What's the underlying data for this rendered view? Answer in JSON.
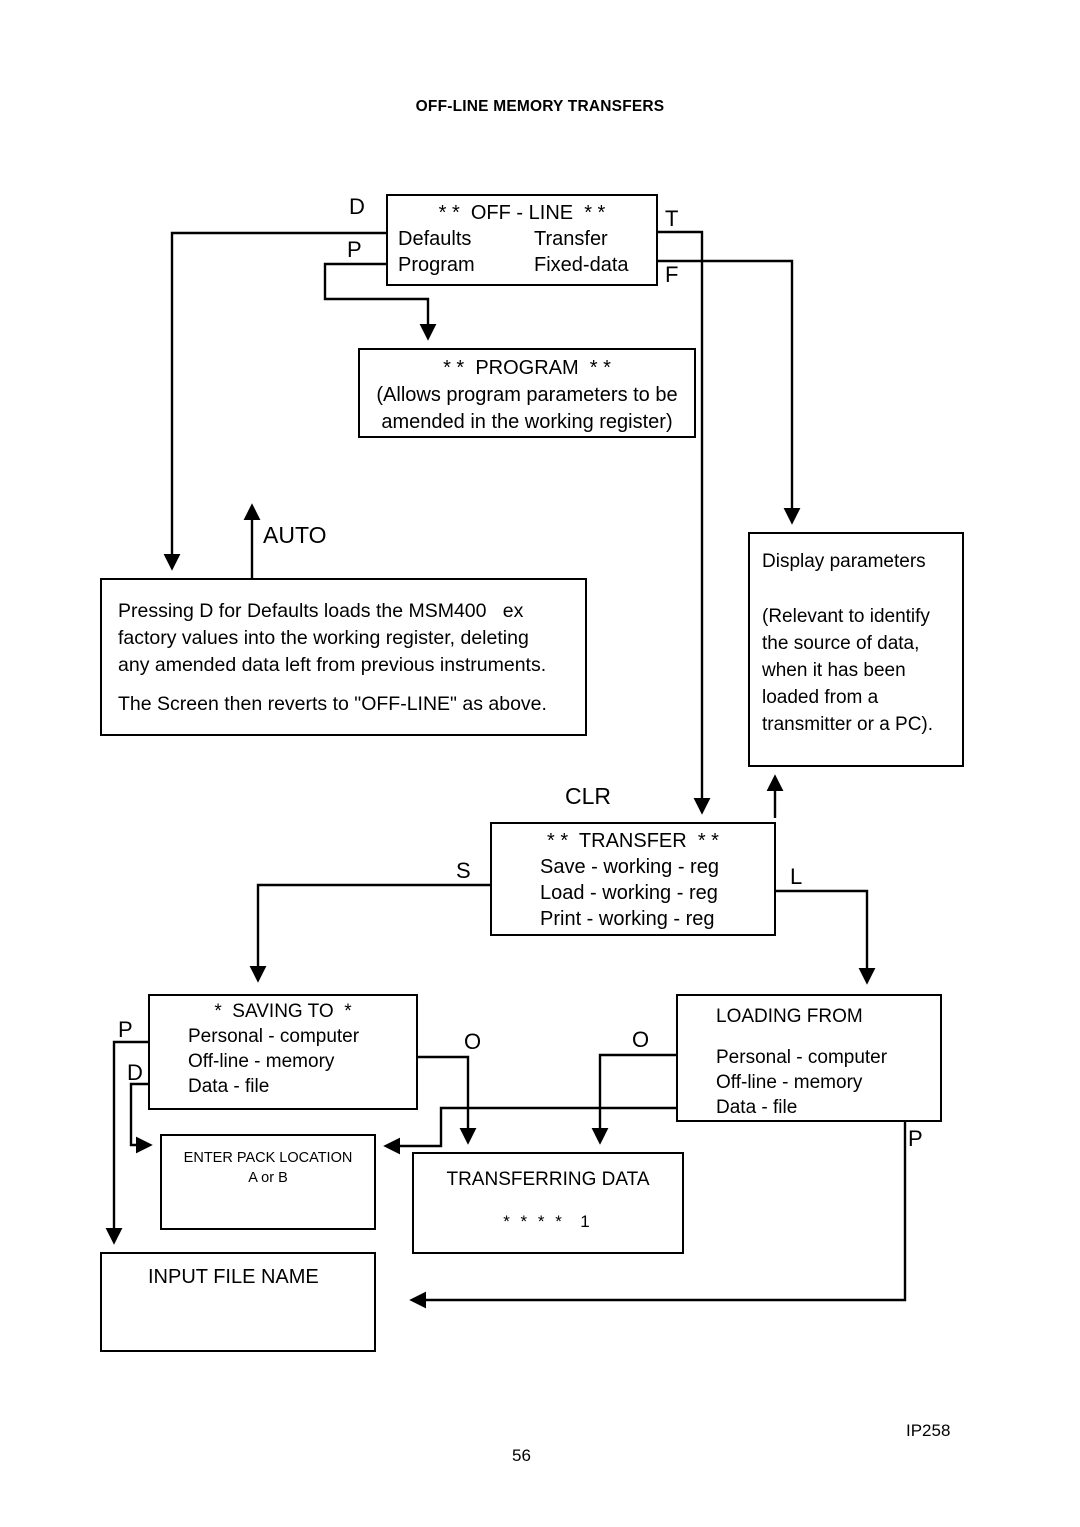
{
  "page": {
    "title": "OFF-LINE MEMORY TRANSFERS",
    "page_number": "56",
    "doc_code": "IP258"
  },
  "nodes": {
    "offline": {
      "header": "* *  OFF - LINE  * *",
      "rows": [
        {
          "left": "Defaults",
          "right": "Transfer"
        },
        {
          "left": "Program",
          "right": "Fixed-data"
        }
      ]
    },
    "program": {
      "header": "* *  PROGRAM  * *",
      "line1": "(Allows program parameters to be",
      "line2": "amended in the working register)"
    },
    "defaults": {
      "line1": "Pressing D for Defaults loads the MSM400   ex",
      "line2": "factory values into the working register, deleting",
      "line3": "any amended data left from previous instruments.",
      "line4": "The Screen then reverts to \"OFF-LINE\" as above."
    },
    "display": {
      "line1": "Display parameters",
      "line2": "(Relevant to identify",
      "line3": "the source of data,",
      "line4": "when it has been",
      "line5": "loaded from a",
      "line6": "transmitter or a PC)."
    },
    "transfer": {
      "header": "* *  TRANSFER  * *",
      "line1": "Save - working - reg",
      "line2": "Load - working - reg",
      "line3": "Print - working - reg"
    },
    "saving": {
      "header": "*  SAVING TO  *",
      "line1": "Personal - computer",
      "line2": "Off-line - memory",
      "line3": "Data - file"
    },
    "loading": {
      "header": "LOADING FROM",
      "line1": "Personal - computer",
      "line2": "Off-line - memory",
      "line3": "Data - file"
    },
    "pack": {
      "line1": "ENTER PACK LOCATION",
      "line2": "A or B"
    },
    "transferring": {
      "line1": "TRANSFERRING DATA",
      "line2": "* * * *  1"
    },
    "filename": {
      "line1": "INPUT FILE NAME"
    }
  },
  "edge_labels": {
    "d_defaults": "D",
    "p_program": "P",
    "t_transfer": "T",
    "f_fixeddata": "F",
    "auto": "AUTO",
    "clr": "CLR",
    "s_save": "S",
    "l_load": "L",
    "p_saving": "P",
    "d_saving": "D",
    "o_saving": "O",
    "o_loading": "O",
    "p_loading": "P"
  },
  "colors": {
    "ink": "#000000",
    "paper": "#ffffff"
  }
}
